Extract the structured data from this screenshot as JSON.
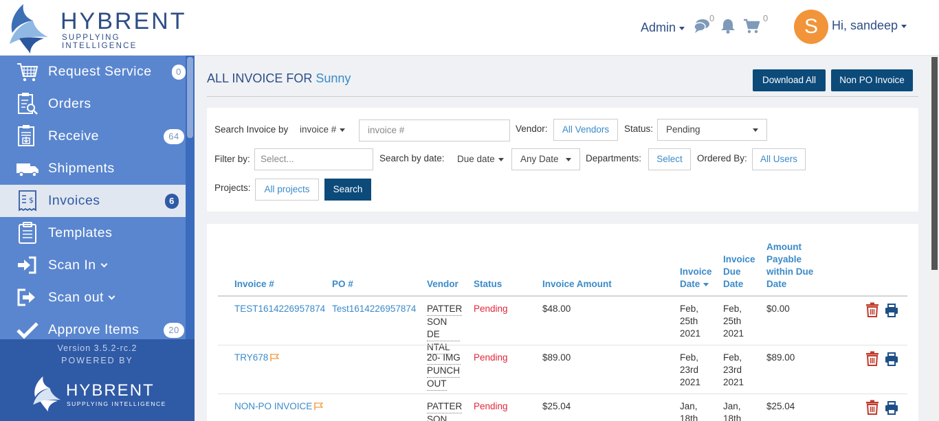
{
  "header": {
    "logo_word": "HYBRENT",
    "logo_tagline": "SUPPLYING INTELLIGENCE",
    "admin_label": "Admin",
    "messages_count": "0",
    "cart_count": "0",
    "avatar_initial": "S",
    "greeting": "Hi, sandeep"
  },
  "sidebar": {
    "items": [
      {
        "label": "Request Service",
        "badge": "0"
      },
      {
        "label": "Orders",
        "badge": ""
      },
      {
        "label": "Receive",
        "badge": "64"
      },
      {
        "label": "Shipments",
        "badge": ""
      },
      {
        "label": "Invoices",
        "badge": "6"
      },
      {
        "label": "Templates",
        "badge": ""
      },
      {
        "label": "Scan In",
        "badge": ""
      },
      {
        "label": "Scan out",
        "badge": ""
      },
      {
        "label": "Approve Items",
        "badge": "20"
      }
    ],
    "version": "Version 3.5.2-rc.2",
    "powered_by": "POWERED BY",
    "footer_logo_word": "HYBRENT",
    "footer_logo_tagline": "SUPPLYING INTELLIGENCE"
  },
  "page": {
    "title_prefix": "ALL INVOICE FOR",
    "title_vendor": "Sunny",
    "download_all": "Download All",
    "non_po_invoice": "Non PO Invoice"
  },
  "search": {
    "search_invoice_by_label": "Search Invoice by",
    "search_type": "invoice #",
    "invoice_placeholder": "invoice #",
    "vendor_label": "Vendor:",
    "vendor_value": "All Vendors",
    "status_label": "Status:",
    "status_value": "Pending",
    "filter_label": "Filter by:",
    "filter_placeholder": "Select...",
    "date_label": "Search by date:",
    "date_type": "Due date",
    "date_range": "Any Date",
    "departments_label": "Departments:",
    "departments_value": "Select",
    "ordered_by_label": "Ordered By:",
    "ordered_by_value": "All Users",
    "projects_label": "Projects:",
    "projects_value": "All projects",
    "search_button": "Search"
  },
  "table": {
    "headers": {
      "invoice_no": "Invoice #",
      "po_no": "PO #",
      "vendor": "Vendor",
      "status": "Status",
      "amount": "Invoice Amount",
      "invoice_date_1": "Invoice",
      "invoice_date_2": "Date",
      "due_date_1": "Invoice",
      "due_date_2": "Due",
      "due_date_3": "Date",
      "payable_1": "Amount",
      "payable_2": "Payable",
      "payable_3": "within Due",
      "payable_4": "Date"
    },
    "rows": [
      {
        "invoice_no": "TEST1614226957874",
        "po_no": "Test1614226957874",
        "vendor_lines": [
          "PATTER",
          "SON DE",
          "NTAL"
        ],
        "status": "Pending",
        "amount": "$48.00",
        "invoice_date_lines": [
          "Feb,",
          "25th",
          "2021"
        ],
        "due_date_lines": [
          "Feb,",
          "25th",
          "2021"
        ],
        "payable": "$0.00",
        "flagged": false
      },
      {
        "invoice_no": "TRY678",
        "po_no": "",
        "vendor_lines": [
          "20- IMG",
          "PUNCH",
          "OUT"
        ],
        "status": "Pending",
        "amount": "$89.00",
        "invoice_date_lines": [
          "Feb,",
          "23rd",
          "2021"
        ],
        "due_date_lines": [
          "Feb,",
          "23rd",
          "2021"
        ],
        "payable": "$89.00",
        "flagged": true
      },
      {
        "invoice_no": "NON-PO INVOICE",
        "po_no": "",
        "vendor_lines": [
          "PATTER",
          "SON DE"
        ],
        "status": "Pending",
        "amount": "$25.04",
        "invoice_date_lines": [
          "Jan,",
          "18th"
        ],
        "due_date_lines": [
          "Jan,",
          "18th"
        ],
        "payable": "$25.04",
        "flagged": true
      }
    ]
  },
  "colors": {
    "primary_dark": "#0c4a7a",
    "sidebar_blue": "#5a86cf",
    "link_blue": "#3a8ac9",
    "pending_red": "#e0263a",
    "avatar_orange": "#f29439"
  }
}
